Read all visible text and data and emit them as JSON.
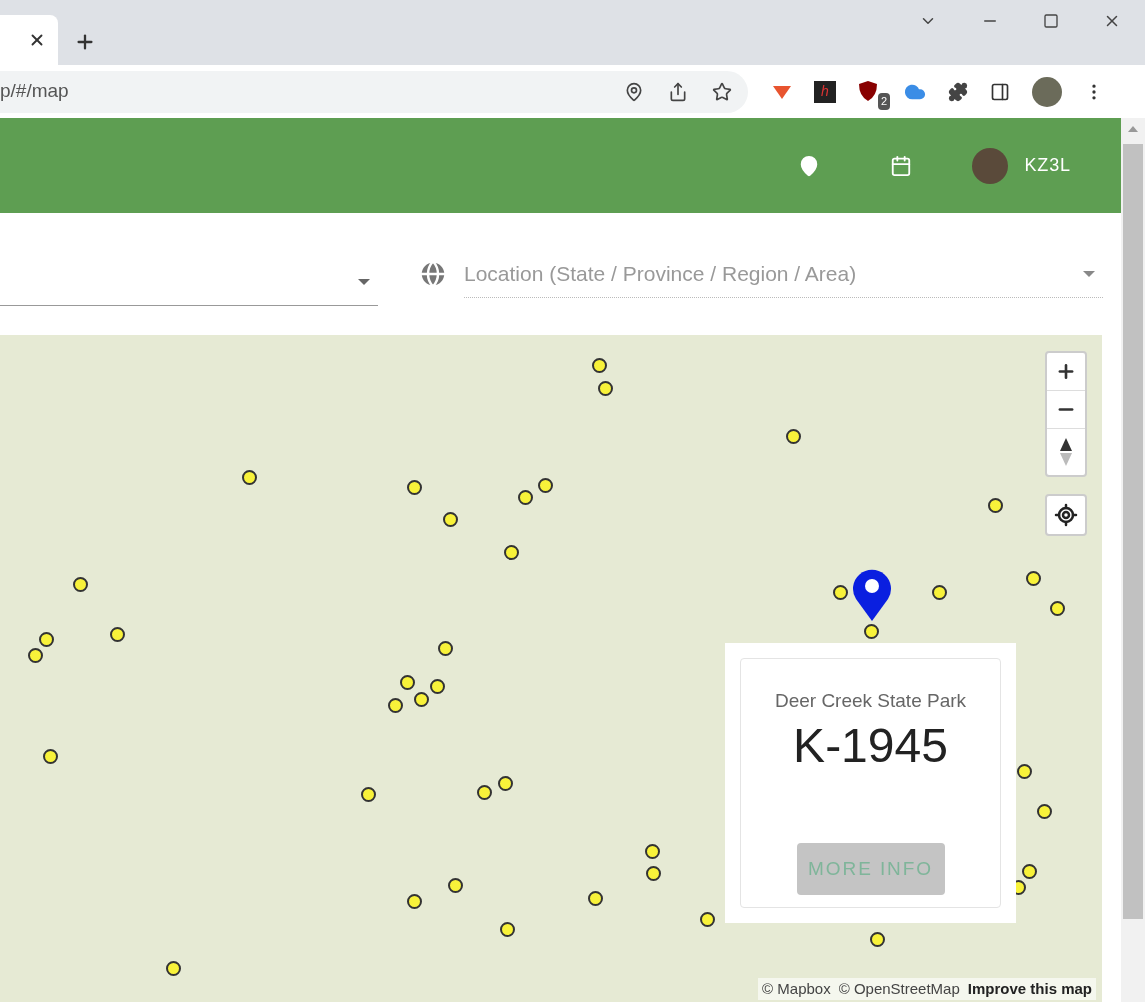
{
  "browser": {
    "url": "p/#/map",
    "extension_logo": "h",
    "extension_badge": "2"
  },
  "header": {
    "user": "KZ3L"
  },
  "filters": [
    {
      "kind": "select"
    },
    {
      "kind": "location",
      "placeholder": "Location (State / Province / Region / Area)"
    }
  ],
  "popup": {
    "park": "Deer Creek State Park",
    "reference": "K-1945",
    "button": "MORE INFO",
    "disabled": true
  },
  "attribution": [
    "© Mapbox",
    "© OpenStreetMap",
    "Improve this map"
  ]
}
